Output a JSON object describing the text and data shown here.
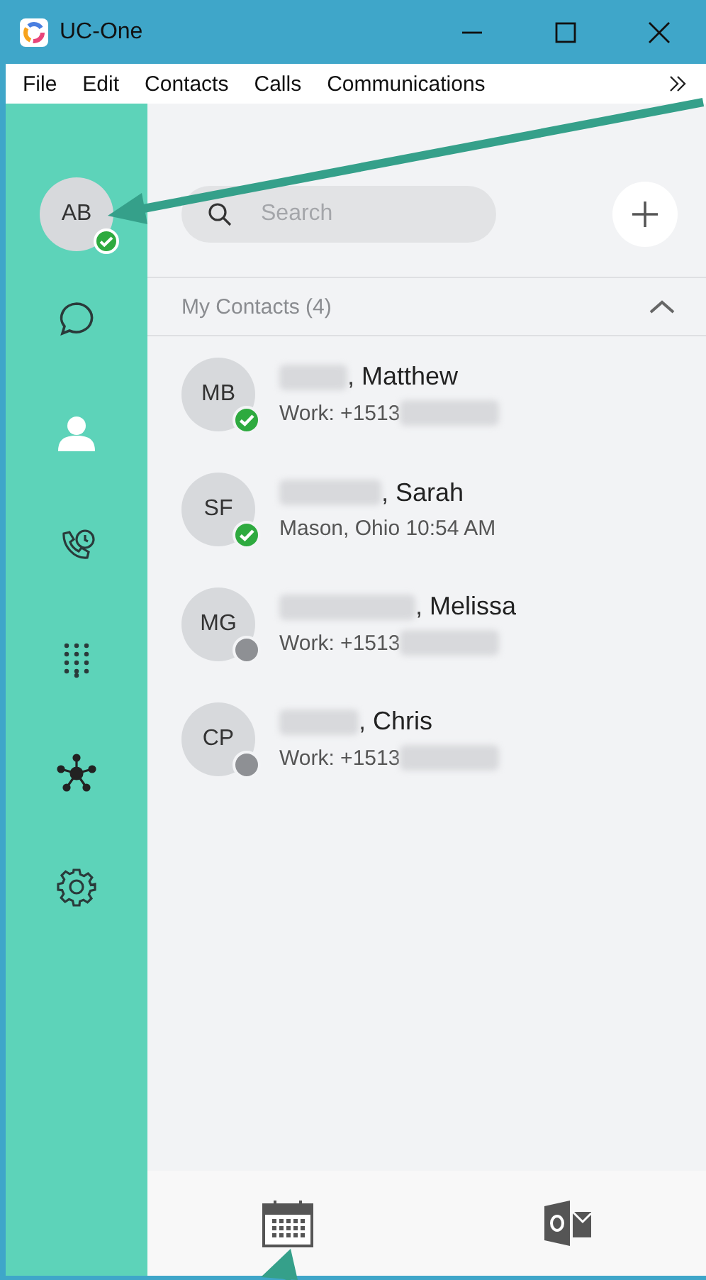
{
  "window": {
    "title": "UC-One"
  },
  "menu": [
    "File",
    "Edit",
    "Contacts",
    "Calls",
    "Communications"
  ],
  "user": {
    "initials": "AB",
    "online": true
  },
  "sidebar": {
    "items": [
      {
        "kind": "chat",
        "selected": false
      },
      {
        "kind": "contacts",
        "selected": true
      },
      {
        "kind": "call-history",
        "selected": false
      },
      {
        "kind": "dialpad",
        "selected": false
      },
      {
        "kind": "network",
        "selected": false
      },
      {
        "kind": "settings",
        "selected": false
      }
    ]
  },
  "search": {
    "placeholder": "Search"
  },
  "group": {
    "title": "My Contacts (4)",
    "expanded": true
  },
  "contacts": [
    {
      "initials": "MB",
      "name": ", Matthew",
      "detail": "Work: +1513",
      "detail_redacted": true,
      "online": true
    },
    {
      "initials": "SF",
      "name": ", Sarah",
      "detail": "Mason, Ohio 10:54 AM",
      "detail_redacted": false,
      "online": true
    },
    {
      "initials": "MG",
      "name": ", Melissa",
      "detail": "Work: +1513",
      "detail_redacted": true,
      "online": false
    },
    {
      "initials": "CP",
      "name": ", Chris",
      "detail": "Work: +1513",
      "detail_redacted": true,
      "online": false
    }
  ],
  "footer": {
    "items": [
      {
        "kind": "calendar"
      },
      {
        "kind": "outlook"
      }
    ]
  }
}
